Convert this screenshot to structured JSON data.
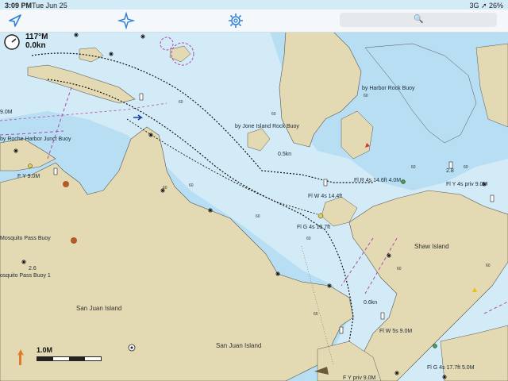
{
  "status": {
    "time": "3:09 PM",
    "date": "Tue Jun 25",
    "right": "3G ➚ 26%"
  },
  "toolbar": {
    "search_placeholder": "🔍"
  },
  "hud": {
    "distance": "117°M",
    "speed": "0.0kn"
  },
  "scale": {
    "label": "1.0M"
  },
  "labels": {
    "harbor_rock": "by Harbor Rock Buoy",
    "jones_island": "by Jone Island Rock Buoy",
    "roche_harbor": "by Roche Harbor Junct Buoy",
    "mosquito1": "Mosquito Pass Buoy",
    "mosquito2": "osquito Pass Buoy 1",
    "san_juan1": "San Juan Island",
    "san_juan2": "San Juan Island",
    "shaw": "Shaw Island",
    "fly9": "F Y 9.0M",
    "fl_r": "Fl R 4s 14.6ft 4.0M",
    "fl_w": "Fl W 4s 14.4ft",
    "fl_g": "Fl G 4s 18.7ft",
    "fl_y4": "Fl Y 4s priv 9.0M",
    "fl_w5": "Fl W 5s 9.0M",
    "fl_g17": "Fl G 4s 17.7ft 5.0M",
    "fy_priv": "F Y priv 9.0M",
    "kn05": "0.5kn",
    "kn06": "0.6kn",
    "m9": "9.0M",
    "d26": "2.6",
    "d28": "2.8"
  }
}
